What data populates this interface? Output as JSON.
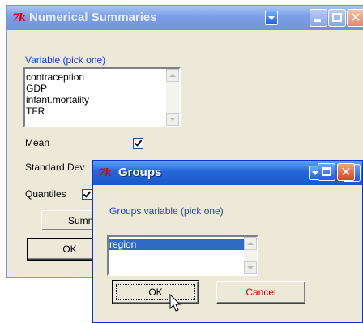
{
  "main_window": {
    "logo": "7k",
    "title": "Numerical Summaries",
    "variable_label": "Variable (pick one)",
    "variables": [
      "contraception",
      "GDP",
      "infant.mortality",
      "TFR"
    ],
    "mean_label": "Mean",
    "std_label": "Standard Dev",
    "quantiles_label": "Quantiles",
    "summarize_label": "Summariz",
    "ok_label": "OK"
  },
  "groups_dialog": {
    "logo": "7k",
    "title": "Groups",
    "groups_label": "Groups variable (pick one)",
    "groups": [
      "region"
    ],
    "ok_label": "OK",
    "cancel_label": "Cancel"
  }
}
